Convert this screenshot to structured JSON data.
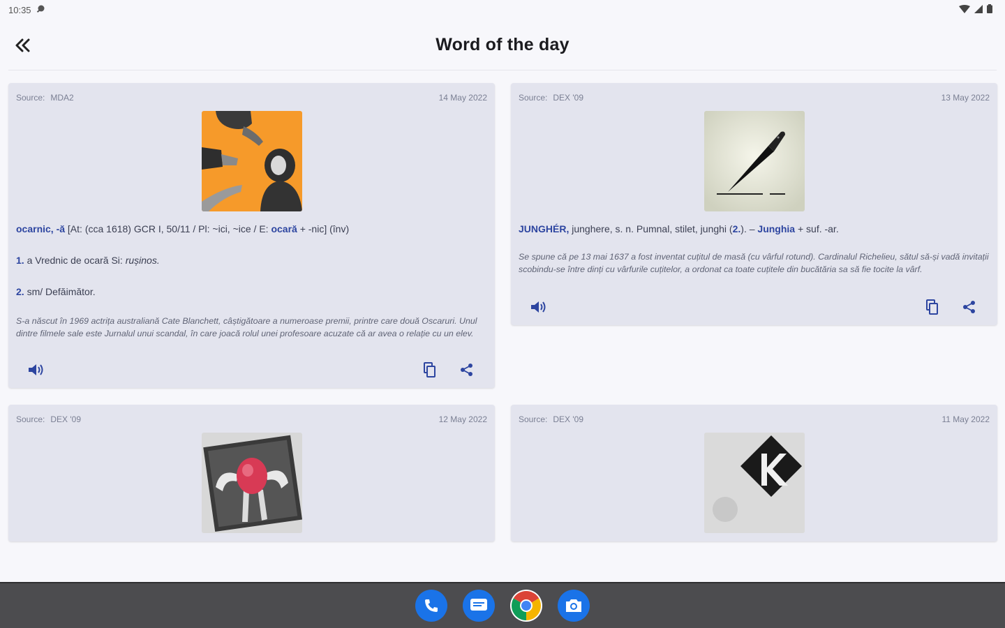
{
  "status_bar": {
    "time": "10:35"
  },
  "app_bar": {
    "title": "Word of the day"
  },
  "source_label": "Source:",
  "cards": [
    {
      "source": "MDA2",
      "date": "14 May 2022",
      "headword": "ocarnic, -ă",
      "etymology_a": " [At: (cca 1618) GCR I, 50/11 / Pl: ~ici, ~ice / E: ",
      "etymology_ref": "ocară",
      "etymology_b": " + -nic] (înv)",
      "meanings": [
        {
          "num": "1.",
          "text": " a Vrednic de ocară Si: ",
          "italic": "rușinos."
        },
        {
          "num": "2.",
          "text": " sm/ Defăimător.",
          "italic": ""
        }
      ],
      "note": "S-a născut în 1969 actrița australiană Cate Blanchett, câștigătoare a numeroase premii, printre care două Oscaruri. Unul dintre filmele sale este Jurnalul unui scandal, în care joacă rolul unei profesoare acuzate că ar avea o relație cu un elev."
    },
    {
      "source": "DEX '09",
      "date": "13 May 2022",
      "headword": "JUNGHÉR,",
      "def_a": " junghere, s. n. Pumnal, stilet, junghi (",
      "def_ref1": "2.",
      "def_b": "). – ",
      "def_ref2": "Junghia",
      "def_c": " + suf. -ar.",
      "note": "Se spune că pe 13 mai 1637 a fost inventat cuțitul de masă (cu vârful rotund). Cardinalul Richelieu, sătul să-și vadă invitații scobindu-se între dinți cu vârfurile cuțitelor, a ordonat ca toate cuțitele din bucătăria sa să fie tocite la vârf."
    },
    {
      "source": "DEX '09",
      "date": "12 May 2022"
    },
    {
      "source": "DEX '09",
      "date": "11 May 2022"
    }
  ],
  "colors": {
    "accent": "#2d45a0",
    "card_bg": "#e3e4ee",
    "nav_bg": "#4c4c4f"
  }
}
